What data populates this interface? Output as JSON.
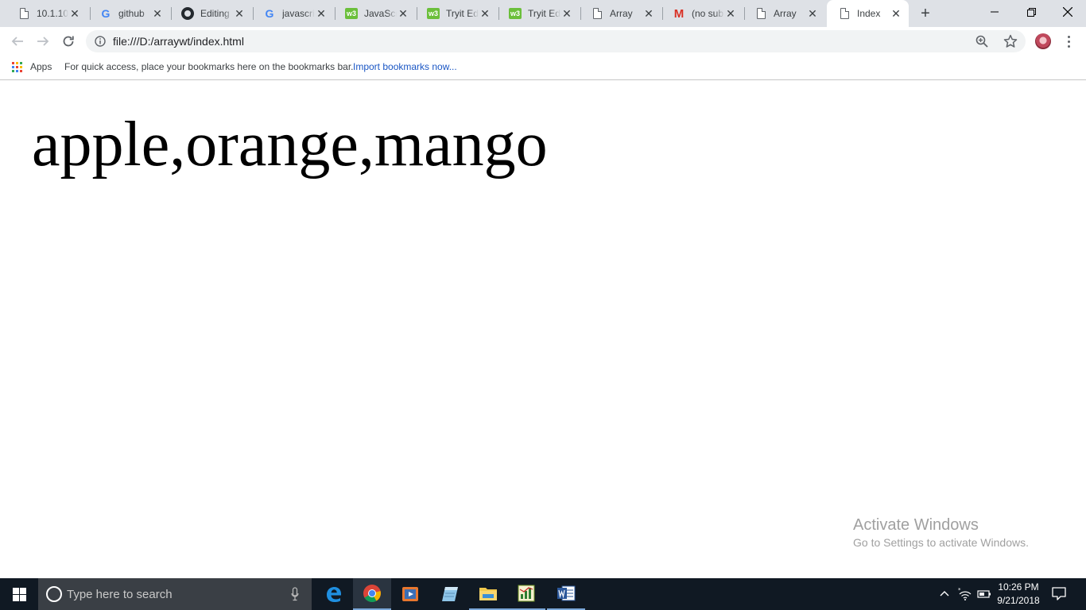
{
  "browser": {
    "tabs": [
      {
        "title": "10.1.10",
        "favicon": "doc-icon"
      },
      {
        "title": "github",
        "favicon": "google-icon"
      },
      {
        "title": "Editing",
        "favicon": "github-icon"
      },
      {
        "title": "javascri",
        "favicon": "google-icon"
      },
      {
        "title": "JavaScr",
        "favicon": "w3schools-icon"
      },
      {
        "title": "Tryit Ed",
        "favicon": "w3schools-icon"
      },
      {
        "title": "Tryit Ed",
        "favicon": "w3schools-icon"
      },
      {
        "title": "Array",
        "favicon": "doc-icon"
      },
      {
        "title": "(no sub",
        "favicon": "gmail-icon"
      },
      {
        "title": "Array",
        "favicon": "doc-icon"
      },
      {
        "title": "Index",
        "favicon": "doc-icon",
        "active": true
      }
    ],
    "new_tab_label": "+",
    "close_glyph": "✕",
    "address_url": "file:///D:/arraywt/index.html",
    "apps_label": "Apps",
    "bookmarks_hint": "For quick access, place your bookmarks here on the bookmarks bar.",
    "import_bookmarks_label": "Import bookmarks now..."
  },
  "page": {
    "text": "apple,orange,mango"
  },
  "watermark": {
    "title": "Activate Windows",
    "subtitle": "Go to Settings to activate Windows."
  },
  "taskbar": {
    "search_placeholder": "Type here to search",
    "apps": [
      "edge-icon",
      "chrome-icon",
      "media-player-icon",
      "notepad-icon",
      "file-explorer-icon",
      "spreadsheet-app-icon",
      "word-icon"
    ],
    "clock_time": "10:26 PM",
    "clock_date": "9/21/2018"
  },
  "colors": {
    "tab_strip": "#dee1e6",
    "link": "#1a56c4",
    "taskbar": "#101923",
    "w3schools": "#6bbf3b",
    "gmail": "#d93025"
  }
}
